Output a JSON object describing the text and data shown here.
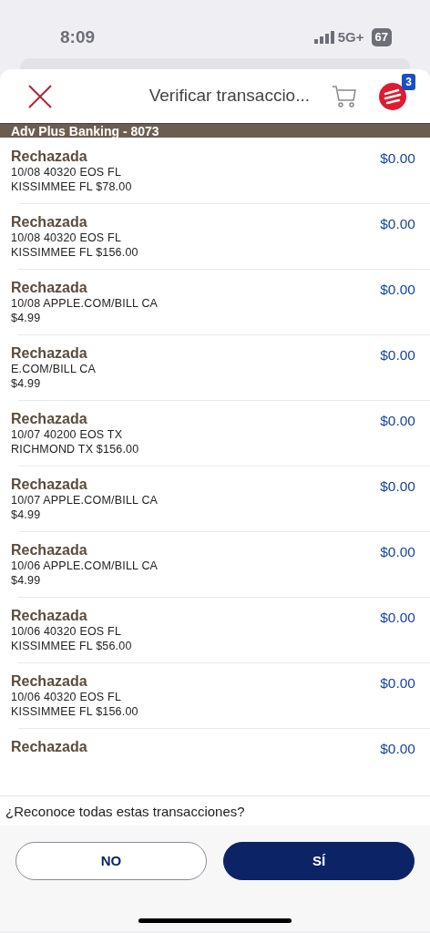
{
  "status_bar": {
    "time": "8:09",
    "network": "5G+",
    "battery": "67"
  },
  "header": {
    "title": "Verificar transaccio...",
    "badge": "3"
  },
  "account": "Adv Plus Banking - 8073",
  "transactions": [
    {
      "status": "Rechazada",
      "line1": "10/08 40320 EOS FL",
      "line2": "KISSIMMEE FL $78.00",
      "amount": "$0.00"
    },
    {
      "status": "Rechazada",
      "line1": "10/08 40320 EOS FL",
      "line2": "KISSIMMEE FL $156.00",
      "amount": "$0.00"
    },
    {
      "status": "Rechazada",
      "line1": "10/08 APPLE.COM/BILL CA",
      "line2": "$4.99",
      "amount": "$0.00"
    },
    {
      "status": "Rechazada",
      "line1": "E.COM/BILL CA",
      "line2": "$4.99",
      "amount": "$0.00"
    },
    {
      "status": "Rechazada",
      "line1": "10/07 40200 EOS TX",
      "line2": "RICHMOND TX $156.00",
      "amount": "$0.00"
    },
    {
      "status": "Rechazada",
      "line1": "10/07 APPLE.COM/BILL CA",
      "line2": "$4.99",
      "amount": "$0.00"
    },
    {
      "status": "Rechazada",
      "line1": "10/06 APPLE.COM/BILL CA",
      "line2": "$4.99",
      "amount": "$0.00"
    },
    {
      "status": "Rechazada",
      "line1": "10/06 40320 EOS FL",
      "line2": "KISSIMMEE FL $56.00",
      "amount": "$0.00"
    },
    {
      "status": "Rechazada",
      "line1": "10/06 40320 EOS FL",
      "line2": "KISSIMMEE FL $156.00",
      "amount": "$0.00"
    },
    {
      "status": "Rechazada",
      "amount": "$0.00"
    }
  ],
  "question": "¿Reconoce todas estas transacciones?",
  "buttons": [
    {
      "label": "NO",
      "kind": "secondary"
    },
    {
      "label": "SÍ",
      "kind": "primary"
    }
  ]
}
